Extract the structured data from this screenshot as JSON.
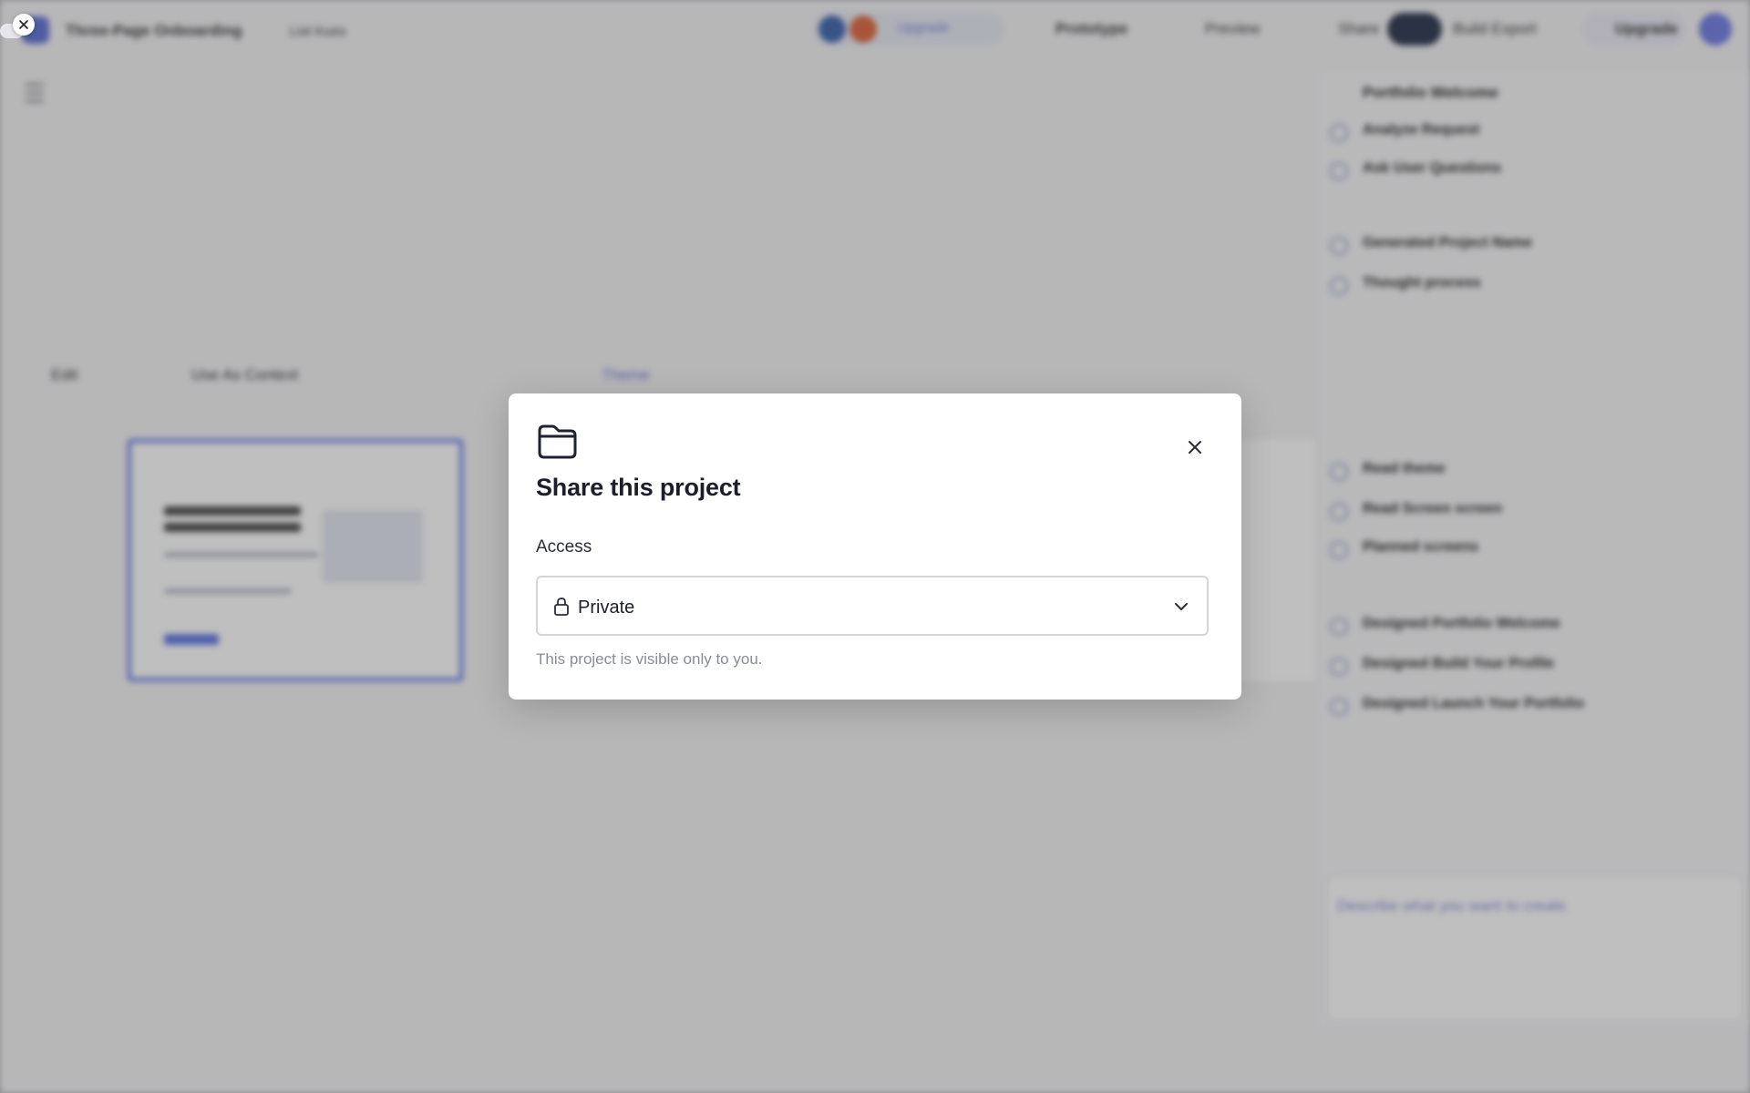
{
  "background": {
    "project_name": "Three-Page Onboarding",
    "project_sub": "List Kues",
    "credits": "Upgrade",
    "prototype": "Prototype",
    "preview": "Preview",
    "share": "Share",
    "build": "Build Export",
    "upgrade": "Upgrade",
    "toolbar": [
      "Edit",
      "Use As Context",
      "Theme"
    ],
    "sidebar_title": "Portfolio Welcome",
    "sidebar_items": [
      "Analyze Request",
      "Ask User Questions",
      "Generated Project Name",
      "Thought process",
      "Read theme",
      "Read Screen screen",
      "Planned screens",
      "Designed Portfolio Welcome",
      "Designed Build Your Profile",
      "Designed Launch Your Portfolio"
    ],
    "composer_placeholder": "Describe what you want to create"
  },
  "modal": {
    "title": "Share this project",
    "access_label": "Access",
    "access_value": "Private",
    "helper_text": "This project is visible only to you.",
    "icons": {
      "header": "folder-icon",
      "close": "close-icon",
      "lock": "lock-icon",
      "dropdown": "chevron-down-icon"
    }
  },
  "colors": {
    "modal_bg": "#ffffff",
    "overlay": "#b9b9bc",
    "accent": "#6b82e6",
    "border": "#d4d5da",
    "helper_text": "#8a8c95"
  }
}
